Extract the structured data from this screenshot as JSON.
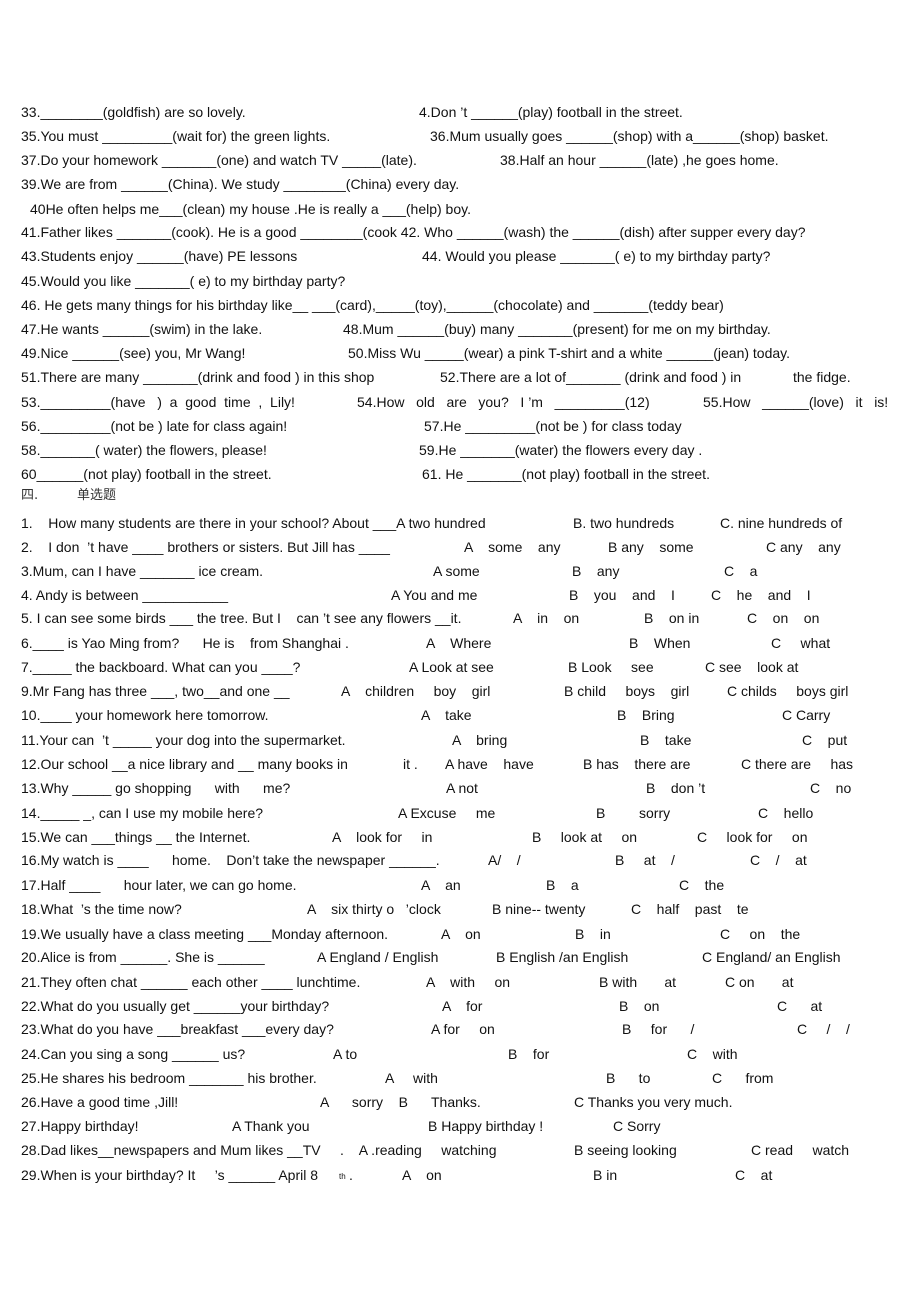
{
  "fill_in": [
    {
      "segs": [
        "33.________(goldfish) are so lovely.",
        "4.Don ’t ______(play) football in the street."
      ]
    },
    {
      "segs": [
        "35.You must _________(wait for) the green lights.",
        "36.Mum usually goes ______(shop) with a______(shop) basket."
      ]
    },
    {
      "segs": [
        "37.Do your homework _______(one) and watch TV _____(late).",
        "38.Half an hour ______(late) ,he goes home."
      ]
    },
    {
      "segs": [
        "39.We are from ______(China). We study ________(China) every day."
      ]
    },
    {
      "segs": [
        "40He often helps me___(clean) my house .He is really a ___(help) boy."
      ]
    },
    {
      "segs": [
        "41.Father likes _______(cook). He is a good ________(cook 42. Who ______(wash) the ______(dish) after supper every day?"
      ]
    },
    {
      "segs": [
        "43.Students enjoy ______(have) PE lessons",
        "44. Would you please _______( e) to my birthday party?"
      ]
    },
    {
      "segs": [
        "45.Would you like _______( e) to my birthday party?"
      ]
    },
    {
      "segs": [
        "46. He gets many things for his birthday like__ ___(card),_____(toy),______(chocolate) and _______(teddy bear)"
      ]
    },
    {
      "segs": [
        "47.He wants ______(swim) in the lake.",
        "48.Mum ______(buy) many _______(present) for me on my birthday."
      ]
    },
    {
      "segs": [
        "49.Nice ______(see) you, Mr Wang!",
        "50.Miss Wu _____(wear) a pink T-shirt and a white ______(jean) today."
      ]
    },
    {
      "segs": [
        "51.There are many _______(drink and food ) in this shop",
        "52.There are a lot of_______ (drink and food ) in",
        "the fidge."
      ]
    },
    {
      "segs": [
        "53._________(have   )  a  good  time  ,  Lily!",
        "54.How   old   are   you?   I ’m   _________(12)",
        "55.How   ______(love)   it   is!"
      ]
    },
    {
      "segs": [
        "56._________(not be ) late for class again!",
        "57.He _________(not be ) for class today"
      ]
    },
    {
      "segs": [
        "58._______( water) the flowers, please!",
        "59.He _______(water) the flowers every day ."
      ]
    },
    {
      "segs": [
        "60______(not play) football in the street.",
        "61. He _______(not play) football in the street."
      ]
    }
  ],
  "section": {
    "number": "四.",
    "title": "单选题"
  },
  "mc": [
    {
      "segs": [
        "1.    How many students are there in your school? About ___A two hundred",
        "B. two hundreds",
        "C. nine hundreds of"
      ]
    },
    {
      "segs": [
        "2.    I don  ’t have ____ brothers or sisters. But Jill has ____",
        "A    some    any",
        "B any    some",
        "C any    any"
      ]
    },
    {
      "segs": [
        "3.Mum, can I have _______ ice cream.",
        "A some",
        "B    any",
        "C    a"
      ]
    },
    {
      "segs": [
        "4. Andy is between ___________",
        "A You and me",
        "B    you    and    I",
        "C    he    and    I"
      ]
    },
    {
      "segs": [
        "5. I can see some birds ___ the tree. But I    can ’t see any flowers __it.",
        "A    in    on",
        "B    on in",
        "C    on    on"
      ]
    },
    {
      "segs": [
        "6.____ is Yao Ming from?      He is    from Shanghai .",
        "A    Where",
        "B    When",
        "C     what"
      ]
    },
    {
      "segs": [
        "7._____ the backboard. What can you ____?",
        "A Look at see",
        "B Look     see",
        "C see    look at"
      ]
    },
    {
      "segs": [
        "9.Mr Fang has three ___, two__and one __",
        "A    children     boy    girl",
        "B child     boys    girl",
        "C childs     boys girl"
      ]
    },
    {
      "segs": [
        "10.____ your homework here tomorrow.",
        "A    take",
        "B    Bring",
        "C Carry"
      ]
    },
    {
      "segs": [
        "11.Your can  ’t _____ your dog into the supermarket.",
        "A    bring",
        "B    take",
        "C    put"
      ]
    },
    {
      "segs": [
        "12.Our school __a nice library and __ many books in",
        "it .",
        "A have    have",
        "B has    there are",
        "C there are     has"
      ]
    },
    {
      "segs": [
        "13.Why _____ go shopping      with      me?",
        "A not",
        "B    don ’t",
        "C    no"
      ]
    },
    {
      "segs": [
        "14._____ _, can I use my mobile here?",
        "A Excuse     me",
        "B",
        "sorry",
        "C    hello"
      ]
    },
    {
      "segs": [
        "15.We can ___things __ the Internet.",
        "A    look for     in",
        "B     look at     on",
        "C     look for     on"
      ]
    },
    {
      "segs": [
        "16.My watch is ____      home.    Don’t take the newspaper ______.",
        "A/    /",
        "B     at    /",
        "C    /    at"
      ]
    },
    {
      "segs": [
        "17.Half ____      hour later, we can go home.",
        "A    an",
        "B    a",
        "C    the"
      ]
    },
    {
      "segs": [
        "18.What  ’s the time now?",
        "A    six thirty o   ’clock",
        "B nine-- twenty",
        "C    half    past    te"
      ]
    },
    {
      "segs": [
        "19.We usually have a class meeting ___Monday afternoon.",
        "A    on",
        "B    in",
        "C     on    the"
      ]
    },
    {
      "segs": [
        "20.Alice is from ______. She is ______",
        "A England / English",
        "B English /an English",
        "C England/ an English"
      ]
    },
    {
      "segs": [
        "21.They often chat ______ each other ____ lunchtime.",
        "A    with     on",
        "B with       at",
        "C on       at"
      ]
    },
    {
      "segs": [
        "22.What do you usually get ______your birthday?",
        "A    for",
        "B    on",
        "C      at"
      ]
    },
    {
      "segs": [
        "23.What do you have ___breakfast ___every day?",
        "A for     on",
        "B     for      /",
        "C     /    /"
      ]
    },
    {
      "segs": [
        "24.Can you sing a song ______ us?",
        "A to",
        "B    for",
        "C    with"
      ]
    },
    {
      "segs": [
        "25.He shares his bedroom _______ his brother.",
        "A     with",
        "B      to",
        "C      from"
      ]
    },
    {
      "segs": [
        "26.Have a good time ,Jill!",
        "A      sorry    B      Thanks.",
        "C Thanks you very much."
      ]
    },
    {
      "segs": [
        "27.Happy birthday!",
        "A Thank you",
        "B Happy birthday !",
        "C Sorry"
      ]
    },
    {
      "segs": [
        "28.Dad likes__newspapers and Mum likes __TV     .    A .reading     watching",
        "B seeing looking",
        "C read     watch"
      ]
    },
    {
      "segs": [
        "29.When is your birthday? It     ’s ______ April 8",
        "th",
        ".",
        "A    on",
        "B in",
        "C    at"
      ]
    }
  ]
}
